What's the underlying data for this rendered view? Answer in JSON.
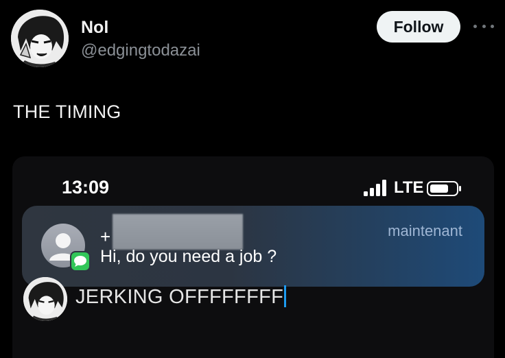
{
  "tweet": {
    "author": {
      "display_name": "Nol",
      "handle": "@edgingtodazai",
      "avatar_icon": "anime-character-avatar"
    },
    "follow_label": "Follow",
    "more_icon": "more-horizontal-icon",
    "text": "THE TIMING"
  },
  "phone_screenshot": {
    "status_bar": {
      "time": "13:09",
      "network": "LTE",
      "signal_icon": "cellular-signal-icon",
      "battery_icon": "battery-icon"
    },
    "notification": {
      "sender_prefix": "+",
      "sender_redacted": true,
      "message": "Hi, do you need a job ?",
      "timestamp": "maintenant",
      "app_icon": "messages-app-icon",
      "contact_icon": "contact-placeholder-icon"
    },
    "compose": {
      "text": "JERKING OFFFFFFFF",
      "avatar_icon": "anime-character-avatar"
    }
  },
  "colors": {
    "background": "#000000",
    "follow_button_bg": "#eff3f4",
    "handle": "#8b9096",
    "caret": "#1d9bf0",
    "messages_green": "#32c659"
  }
}
